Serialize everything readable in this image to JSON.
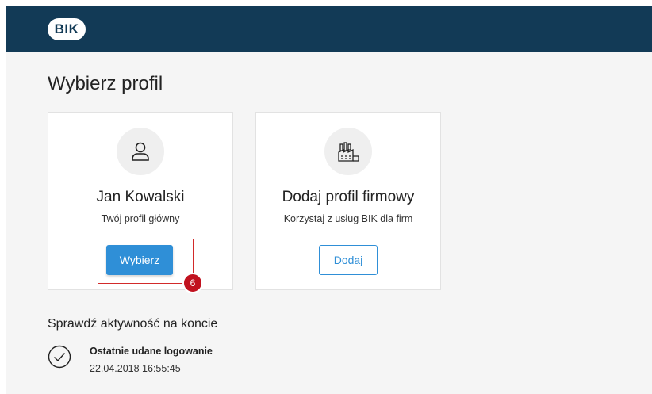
{
  "header": {
    "logo_text": "BIK",
    "bg_color": "#123a56"
  },
  "page_title": "Wybierz profil",
  "profiles": [
    {
      "icon": "user-icon",
      "name": "Jan Kowalski",
      "subtitle": "Twój profil główny",
      "button_label": "Wybierz",
      "button_color": "#2f8fd7"
    },
    {
      "icon": "factory-icon",
      "name": "Dodaj profil firmowy",
      "subtitle": "Korzystaj z usług BIK dla firm",
      "button_label": "Dodaj"
    }
  ],
  "annotation": {
    "step_number": "6",
    "highlight_color": "#d22a2a",
    "badge_color": "#c1121f"
  },
  "activity": {
    "title": "Sprawdź aktywność na koncie",
    "icon": "check-circle-icon",
    "last_login_label": "Ostatnie udane logowanie",
    "last_login_time": "22.04.2018 16:55:45"
  }
}
